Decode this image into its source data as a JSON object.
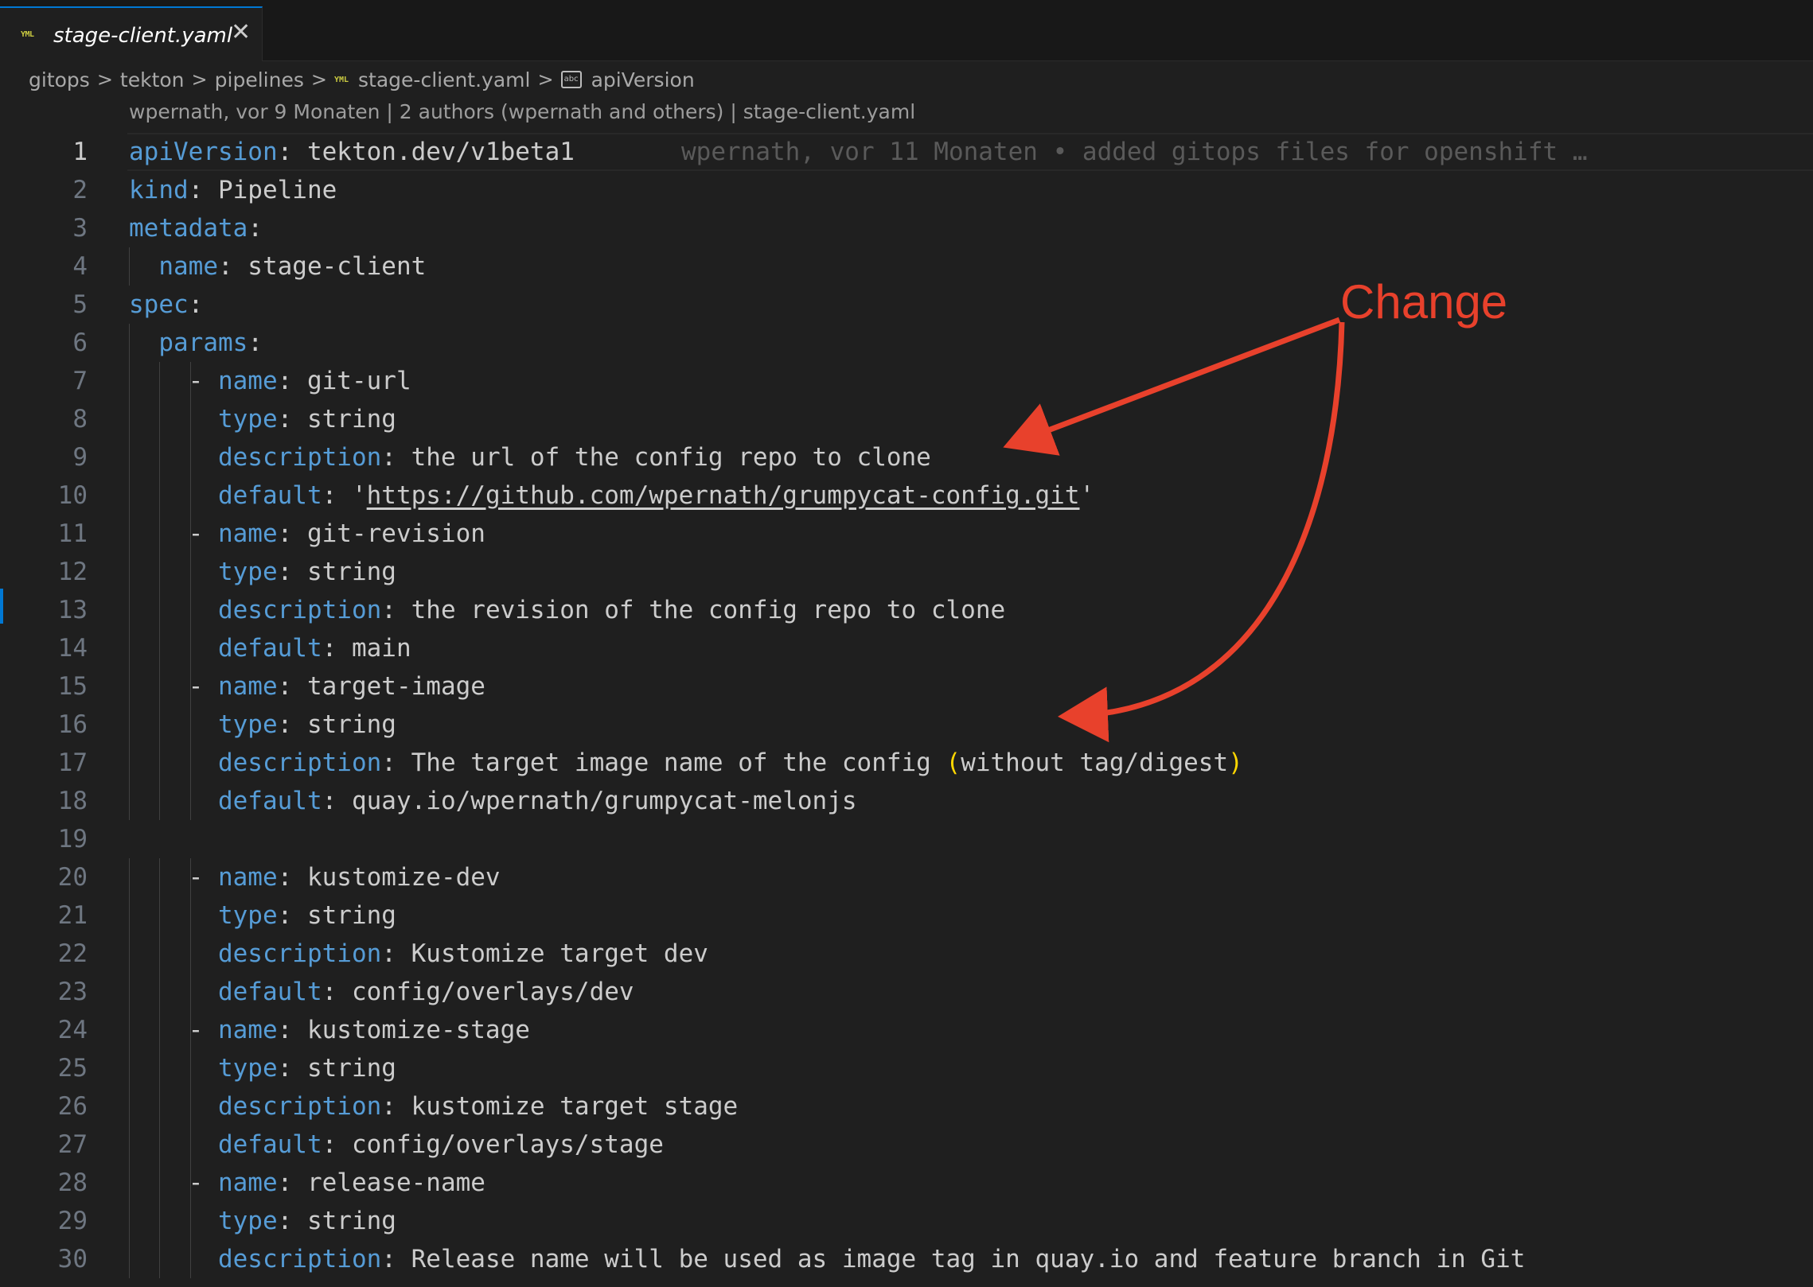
{
  "tab": {
    "icon": "yaml-file-icon",
    "label": "stage-client.yaml",
    "close": "✕"
  },
  "breadcrumb": {
    "parts": [
      "gitops",
      "tekton",
      "pipelines"
    ],
    "file": "stage-client.yaml",
    "symbol": "apiVersion",
    "separator": ">",
    "yml_glyph": "YML",
    "abc_glyph": "abc"
  },
  "blame_header": "wpernath, vor 9 Monaten | 2 authors (wpernath and others) | stage-client.yaml",
  "inline_blame": "wpernath, vor 11 Monaten • added gitops files for openshift …",
  "annotation": {
    "text": "Change",
    "color": "#e8412c"
  },
  "colors": {
    "key": "#569cd6",
    "text": "#cccccc",
    "paren": "#ffd700",
    "background": "#1f1f1f",
    "accent": "#0078d4"
  },
  "lines": [
    {
      "n": "1",
      "pre": "",
      "key": "apiVersion",
      "post": ": tekton.dev/v1beta1"
    },
    {
      "n": "2",
      "pre": "",
      "key": "kind",
      "post": ": Pipeline"
    },
    {
      "n": "3",
      "pre": "",
      "key": "metadata",
      "post": ":"
    },
    {
      "n": "4",
      "pre": "  ",
      "key": "name",
      "post": ": stage-client"
    },
    {
      "n": "5",
      "pre": "",
      "key": "spec",
      "post": ":"
    },
    {
      "n": "6",
      "pre": "  ",
      "key": "params",
      "post": ":"
    },
    {
      "n": "7",
      "pre": "    - ",
      "key": "name",
      "post": ": git-url"
    },
    {
      "n": "8",
      "pre": "      ",
      "key": "type",
      "post": ": string"
    },
    {
      "n": "9",
      "pre": "      ",
      "key": "description",
      "post": ": the url of the config repo to clone"
    },
    {
      "n": "10",
      "pre": "      ",
      "key": "default",
      "post": ": '",
      "url": "https://github.com/wpernath/grumpycat-config.git",
      "post2": "'"
    },
    {
      "n": "11",
      "pre": "    - ",
      "key": "name",
      "post": ": git-revision"
    },
    {
      "n": "12",
      "pre": "      ",
      "key": "type",
      "post": ": string"
    },
    {
      "n": "13",
      "pre": "      ",
      "key": "description",
      "post": ": the revision of the config repo to clone"
    },
    {
      "n": "14",
      "pre": "      ",
      "key": "default",
      "post": ": main"
    },
    {
      "n": "15",
      "pre": "    - ",
      "key": "name",
      "post": ": target-image"
    },
    {
      "n": "16",
      "pre": "      ",
      "key": "type",
      "post": ": string"
    },
    {
      "n": "17",
      "pre": "      ",
      "key": "description",
      "post": ": The target image name of the config ",
      "paren_open": "(",
      "post2": "without tag/digest",
      "paren_close": ")"
    },
    {
      "n": "18",
      "pre": "      ",
      "key": "default",
      "post": ": quay.io/wpernath/grumpycat-melonjs"
    },
    {
      "n": "19",
      "pre": "",
      "key": "",
      "post": ""
    },
    {
      "n": "20",
      "pre": "    - ",
      "key": "name",
      "post": ": kustomize-dev"
    },
    {
      "n": "21",
      "pre": "      ",
      "key": "type",
      "post": ": string"
    },
    {
      "n": "22",
      "pre": "      ",
      "key": "description",
      "post": ": Kustomize target dev"
    },
    {
      "n": "23",
      "pre": "      ",
      "key": "default",
      "post": ": config/overlays/dev"
    },
    {
      "n": "24",
      "pre": "    - ",
      "key": "name",
      "post": ": kustomize-stage"
    },
    {
      "n": "25",
      "pre": "      ",
      "key": "type",
      "post": ": string"
    },
    {
      "n": "26",
      "pre": "      ",
      "key": "description",
      "post": ": kustomize target stage"
    },
    {
      "n": "27",
      "pre": "      ",
      "key": "default",
      "post": ": config/overlays/stage"
    },
    {
      "n": "28",
      "pre": "    - ",
      "key": "name",
      "post": ": release-name"
    },
    {
      "n": "29",
      "pre": "      ",
      "key": "type",
      "post": ": string"
    },
    {
      "n": "30",
      "pre": "      ",
      "key": "description",
      "post": ": Release name will be used as image tag in quay.io and feature branch in Git"
    }
  ]
}
